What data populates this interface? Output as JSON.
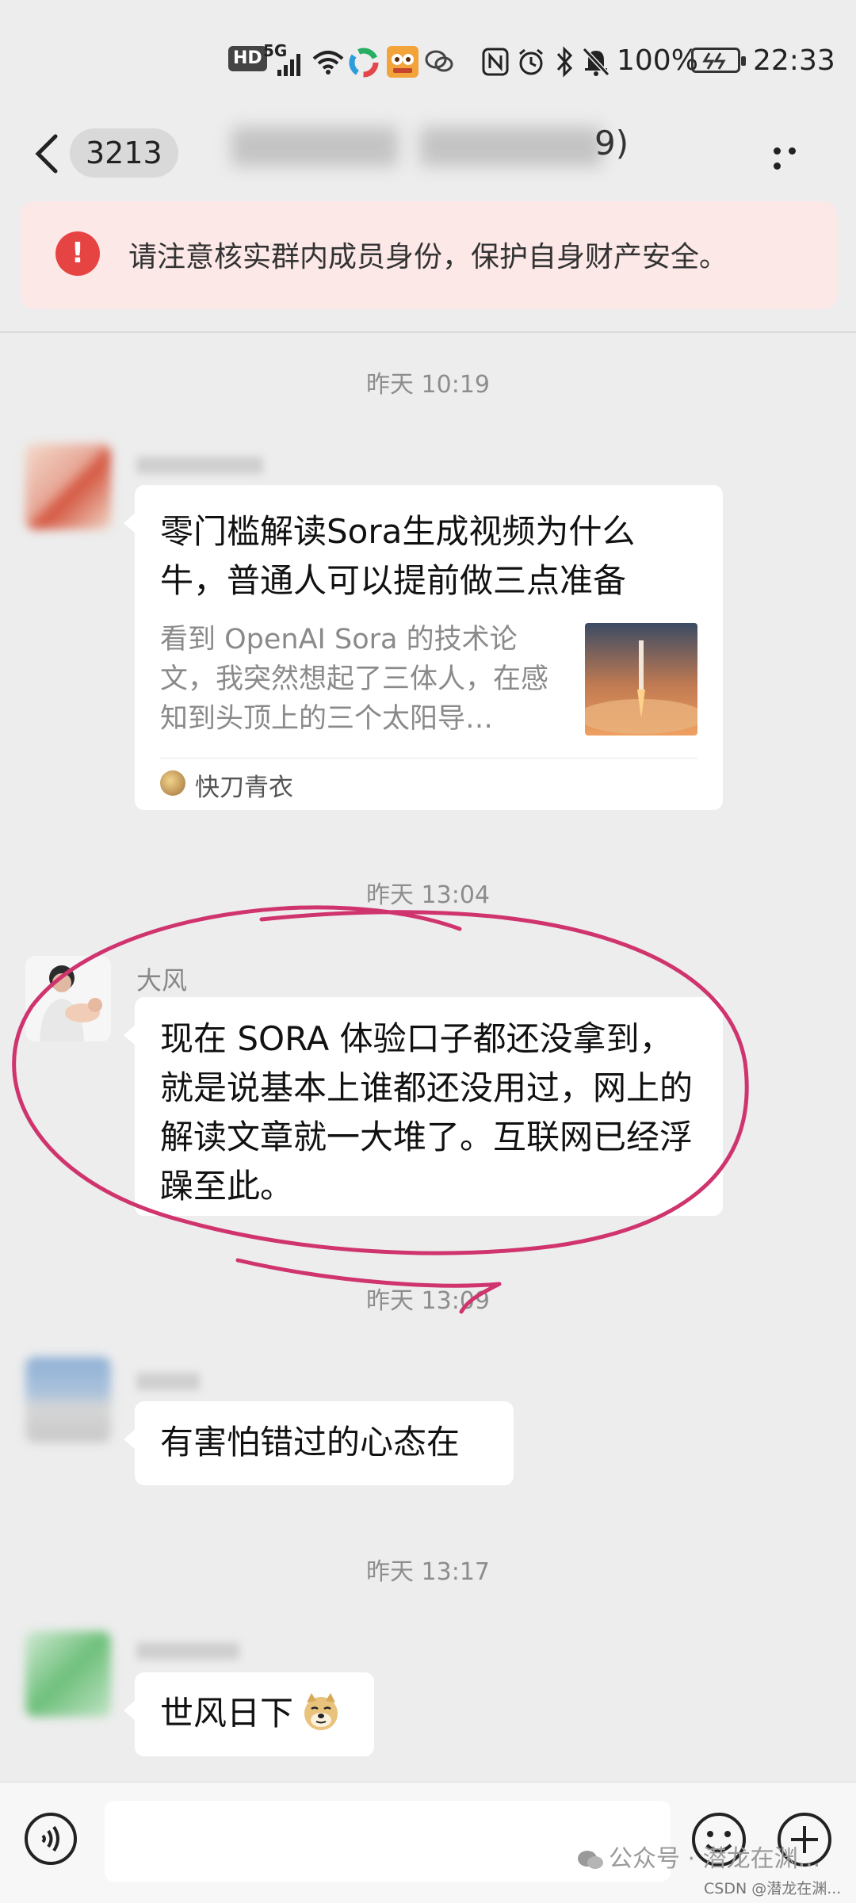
{
  "status_bar": {
    "hd": "HD",
    "network": "5G",
    "battery": "100%",
    "time": "22:33"
  },
  "header": {
    "unread_count": "3213",
    "title_suffix": "9)",
    "more_icon": "more-dots-icon",
    "back_icon": "chevron-left-icon"
  },
  "warning": {
    "icon": "!",
    "text": "请注意核实群内成员身份，保护自身财产安全。",
    "color": "#e64343"
  },
  "messages": {
    "ts1": "昨天 10:19",
    "card": {
      "title": "零门槛解读Sora生成视频为什么牛，普通人可以提前做三点准备",
      "description": "看到 OpenAI Sora 的技术论文，我突然想起了三体人，在感知到头顶上的三个太阳导…",
      "source": "快刀青衣"
    },
    "ts2": "昨天 13:04",
    "msg2": {
      "sender": "大风",
      "text": "现在 SORA 体验口子都还没拿到，就是说基本上谁都还没用过，网上的解读文章就一大堆了。互联网已经浮躁至此。"
    },
    "ts3": "昨天 13:09",
    "msg3": {
      "text": "有害怕错过的心态在"
    },
    "ts4": "昨天 13:17",
    "msg4": {
      "text": "世风日下"
    }
  },
  "annotation": {
    "color": "#d0346e"
  },
  "input": {
    "placeholder": "",
    "voice_icon": "voice-icon",
    "emoji_icon": "emoji-icon",
    "plus_icon": "plus-icon"
  },
  "watermark": {
    "text": "公众号 · 潜龙在渊...",
    "csdn": "CSDN @潜龙在渊..."
  }
}
